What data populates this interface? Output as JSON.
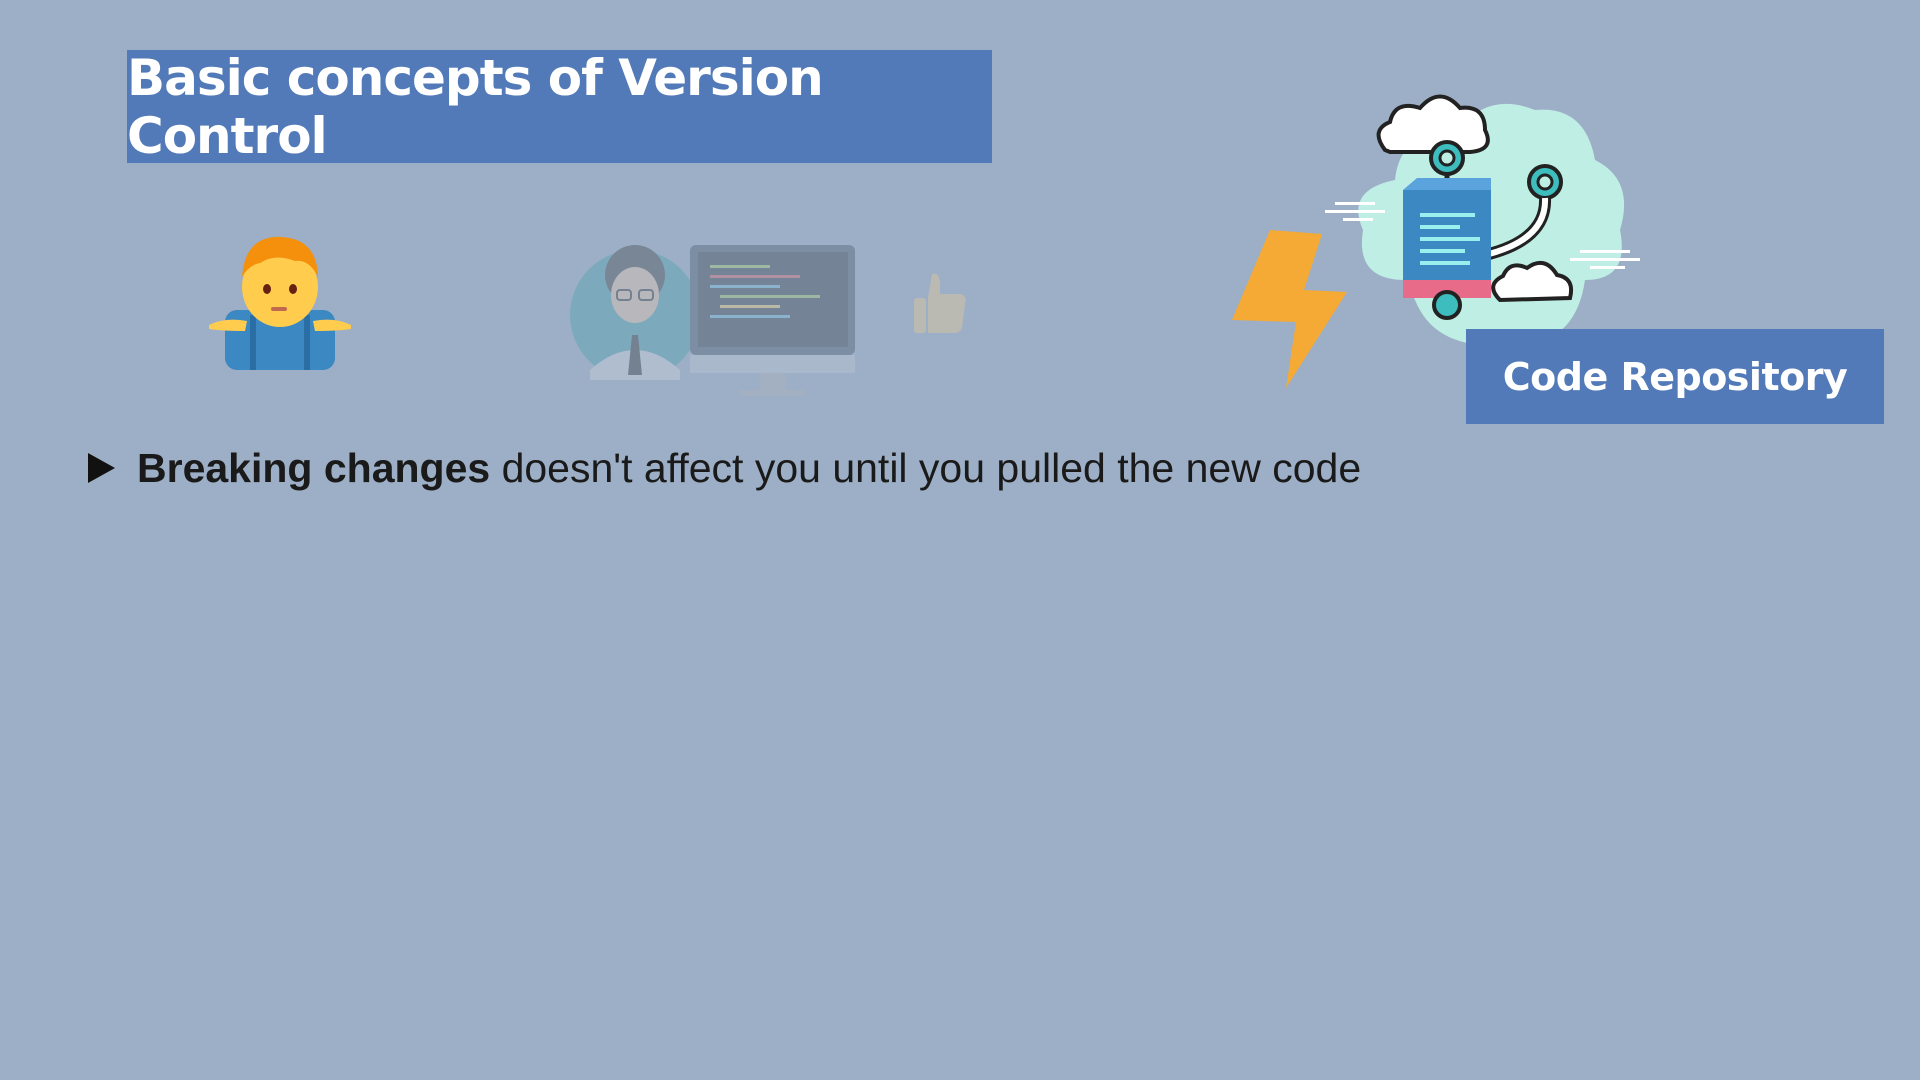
{
  "title": "Basic concepts of Version Control",
  "repository_label": "Code Repository",
  "bullet": {
    "strong": "Breaking changes",
    "rest": " doesn't affect you until you pulled the new code"
  },
  "icons": {
    "person": "person-shrugging-icon",
    "developer": "developer-at-computer-icon",
    "thumbs_up": "thumbs-up-icon",
    "lightning": "lightning-bolt-icon",
    "repository": "cloud-repository-icon"
  },
  "colors": {
    "background": "#9cafc6",
    "title_box": "#527ab8",
    "repository_box": "#527ab8",
    "lightning": "#f4aa35"
  }
}
